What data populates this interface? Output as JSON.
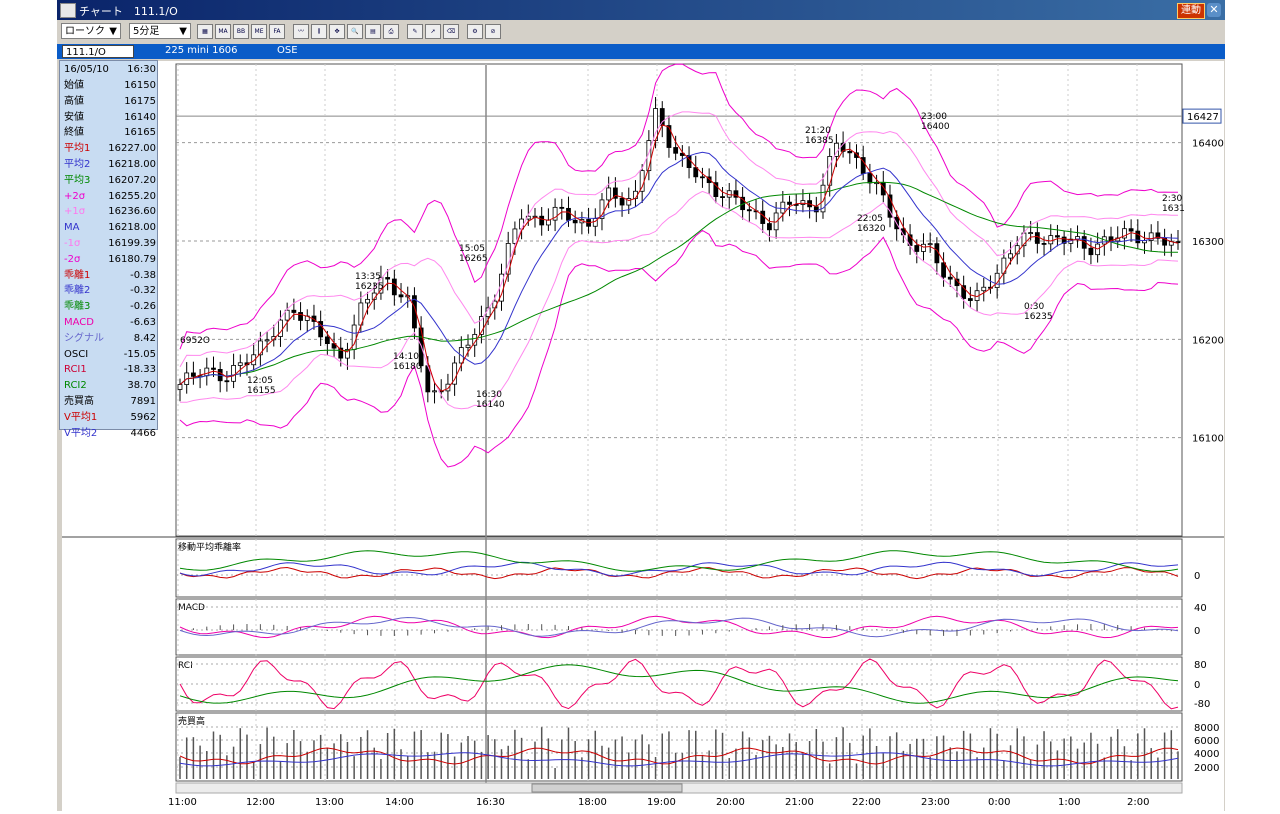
{
  "window": {
    "title": "チャート　111.1/O",
    "link_button": "連動",
    "close_icon": "close-icon"
  },
  "toolbar": {
    "chart_type": "ローソク",
    "interval": "5分足",
    "icon_labels": [
      "MA",
      "BB",
      "ME",
      "FA"
    ]
  },
  "symbol": {
    "code": "111.1/O",
    "name": "225 mini 1606",
    "exchange": "OSE"
  },
  "info": {
    "date": "16/05/10",
    "time": "16:30",
    "rows": [
      {
        "label": "始値",
        "value": "16150",
        "color": "#000000"
      },
      {
        "label": "高値",
        "value": "16175",
        "color": "#000000"
      },
      {
        "label": "安値",
        "value": "16140",
        "color": "#000000"
      },
      {
        "label": "終値",
        "value": "16165",
        "color": "#000000"
      },
      {
        "label": "平均1",
        "value": "16227.00",
        "color": "#cc0000"
      },
      {
        "label": "平均2",
        "value": "16218.00",
        "color": "#3333cc"
      },
      {
        "label": "平均3",
        "value": "16207.20",
        "color": "#008800"
      },
      {
        "label": "+2σ",
        "value": "16255.20",
        "color": "#ee00cc"
      },
      {
        "label": "+1σ",
        "value": "16236.60",
        "color": "#ff77ee"
      },
      {
        "label": "MA",
        "value": "16218.00",
        "color": "#3333cc"
      },
      {
        "label": "-1σ",
        "value": "16199.39",
        "color": "#ff77ee"
      },
      {
        "label": "-2σ",
        "value": "16180.79",
        "color": "#ee00cc"
      },
      {
        "label": "乖離1",
        "value": "-0.38",
        "color": "#cc0000"
      },
      {
        "label": "乖離2",
        "value": "-0.32",
        "color": "#3333cc"
      },
      {
        "label": "乖離3",
        "value": "-0.26",
        "color": "#008800"
      },
      {
        "label": "MACD",
        "value": "-6.63",
        "color": "#ee00aa"
      },
      {
        "label": "シグナル",
        "value": "8.42",
        "color": "#6666cc"
      },
      {
        "label": "OSCI",
        "value": "-15.05",
        "color": "#000000"
      },
      {
        "label": "RCI1",
        "value": "-18.33",
        "color": "#cc0033"
      },
      {
        "label": "RCI2",
        "value": "38.70",
        "color": "#008800"
      },
      {
        "label": "売買高",
        "value": "7891",
        "color": "#000000"
      },
      {
        "label": "V平均1",
        "value": "5962",
        "color": "#cc0000"
      },
      {
        "label": "V平均2",
        "value": "4466",
        "color": "#3333cc"
      }
    ]
  },
  "chart_data": [
    {
      "type": "candlestick",
      "title": "",
      "current_price_label": "16427",
      "y_ticks": [
        "16400",
        "16300",
        "16200",
        "16100"
      ],
      "ylim": [
        16000,
        16480
      ],
      "x_ticks": [
        "11:00",
        "12:00",
        "13:00",
        "14:00",
        "16:30",
        "18:00",
        "19:00",
        "20:00",
        "21:00",
        "22:00",
        "23:00",
        "0:00",
        "1:00",
        "2:00"
      ],
      "annotations": [
        {
          "time": "6952O",
          "price": ""
        },
        {
          "time": "12:05",
          "price": "16155"
        },
        {
          "time": "13:35",
          "price": "16235"
        },
        {
          "time": "14:10",
          "price": "16180"
        },
        {
          "time": "15:05",
          "price": "16265"
        },
        {
          "time": "16:30",
          "price": "16140"
        },
        {
          "time": "21:20",
          "price": "16385"
        },
        {
          "time": "22:05",
          "price": "16320"
        },
        {
          "time": "23:00",
          "price": "16400"
        },
        {
          "time": "0:30",
          "price": "16235"
        },
        {
          "time": "2:30",
          "price": "1631"
        }
      ],
      "key_closes": [
        16150,
        16175,
        16155,
        16185,
        16200,
        16235,
        16210,
        16180,
        16230,
        16265,
        16240,
        16140,
        16165,
        16210,
        16250,
        16330,
        16320,
        16330,
        16315,
        16350,
        16340,
        16430,
        16385,
        16360,
        16350,
        16330,
        16320,
        16340,
        16335,
        16400,
        16380,
        16340,
        16300,
        16290,
        16260,
        16235,
        16270,
        16300,
        16305,
        16300,
        16295,
        16300,
        16310,
        16300,
        16295
      ]
    },
    {
      "type": "line",
      "title": "移動平均乖離率",
      "y_ticks": [
        "0"
      ],
      "series": [
        "乖離1",
        "乖離2",
        "乖離3"
      ]
    },
    {
      "type": "line",
      "title": "MACD",
      "y_ticks": [
        "40",
        "0"
      ],
      "series": [
        "MACD",
        "シグナル",
        "OSCI"
      ]
    },
    {
      "type": "line",
      "title": "RCI",
      "y_ticks": [
        "80",
        "0",
        "-80"
      ],
      "series": [
        "RCI1",
        "RCI2"
      ]
    },
    {
      "type": "bar",
      "title": "売買高",
      "y_ticks": [
        "8000",
        "6000",
        "4000",
        "2000"
      ],
      "series": [
        "売買高",
        "V平均1",
        "V平均2"
      ]
    }
  ],
  "colors": {
    "ma1": "#cc0000",
    "ma2": "#3333cc",
    "ma3": "#008800",
    "bb2": "#ee00cc",
    "bb1": "#ff88ee",
    "grid": "#999999"
  }
}
